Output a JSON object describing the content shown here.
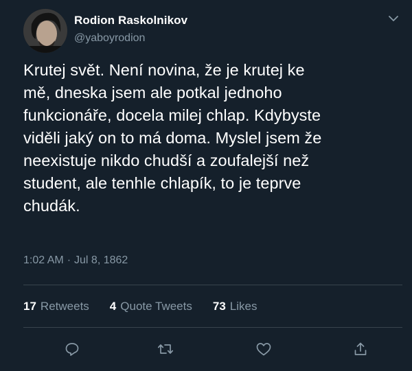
{
  "tweet": {
    "author_name": "Rodion Raskolnikov",
    "author_handle": "@yaboyrodion",
    "text": "Krutej svět. Není novina, že je krutej ke\nmě, dneska jsem ale potkal jednoho\nfunkcionáře, docela milej chlap. Kdybyste\nviděli jaký on to má doma. Myslel jsem že\nneexistuje nikdo chudší a zoufalejší než\nstudent, ale tenhle chlapík, to je teprve\nchudák.",
    "time": "1:02 AM",
    "date_sep": "·",
    "date": "Jul 8, 1862"
  },
  "stats": {
    "retweets_count": "17",
    "retweets_label": "Retweets",
    "quote_count": "4",
    "quote_label": "Quote Tweets",
    "likes_count": "73",
    "likes_label": "Likes"
  },
  "icons": {
    "caret": "chevron-down-icon",
    "reply": "reply-icon",
    "retweet": "retweet-icon",
    "like": "heart-icon",
    "share": "share-icon"
  },
  "colors": {
    "background": "#15202b",
    "secondary_text": "#8899a6",
    "divider": "#38444d",
    "primary_text": "#ffffff"
  }
}
